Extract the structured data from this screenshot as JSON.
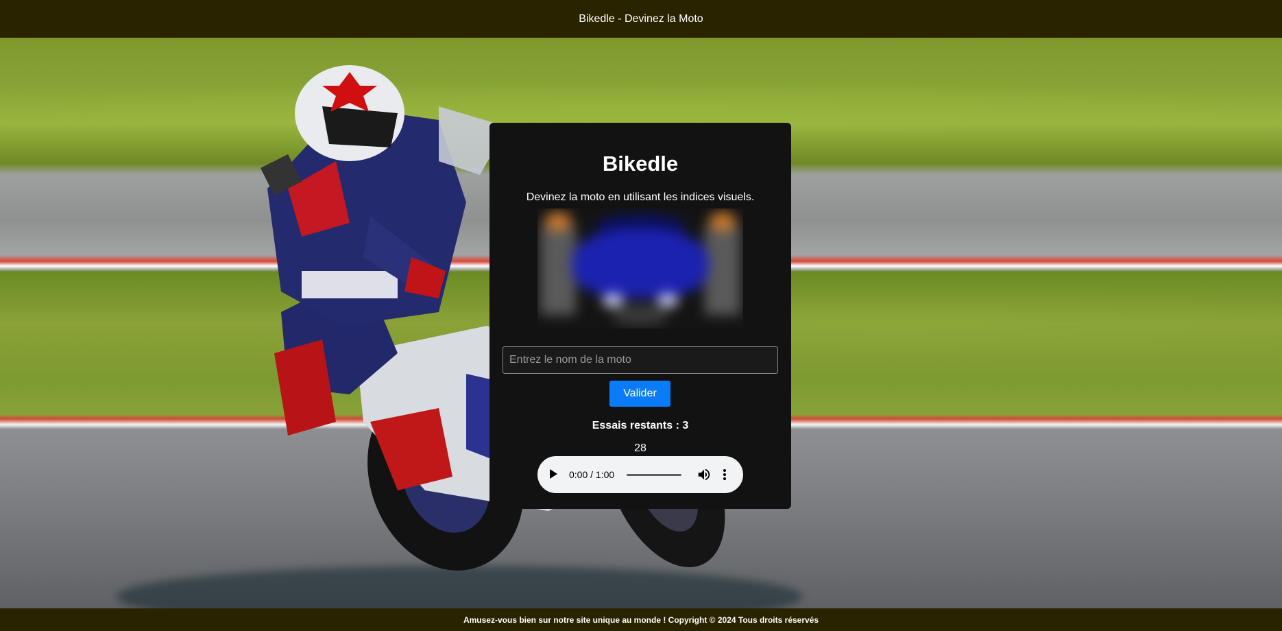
{
  "header": {
    "title": "Bikedle - Devinez la Moto"
  },
  "game": {
    "title": "Bikedle",
    "subtitle": "Devinez la moto en utilisant les indices visuels.",
    "input_placeholder": "Entrez le nom de la moto",
    "input_value": "",
    "submit_label": "Valider",
    "tries_remaining": "Essais restants : 3",
    "countdown": "28"
  },
  "audio": {
    "time": "0:00 / 1:00",
    "progress": 0
  },
  "footer": {
    "text": "Amusez-vous bien sur notre site unique au monde ! Copyright © 2024 Tous droits réservés"
  },
  "colors": {
    "bar": "#2a2300",
    "card": "#121212",
    "button": "#0a7cf8"
  },
  "icons": [
    "play-icon",
    "volume-icon",
    "more-options-icon"
  ]
}
